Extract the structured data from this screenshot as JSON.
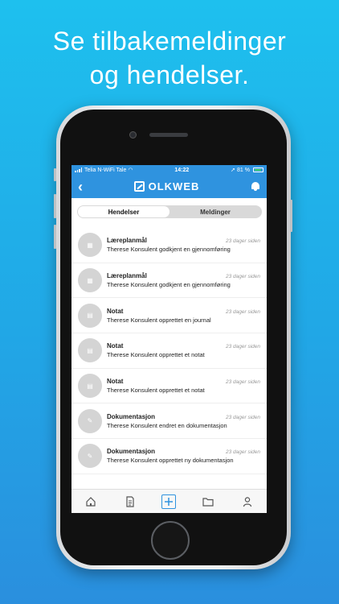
{
  "headline": {
    "line1": "Se tilbakemeldinger",
    "line2": "og hendelser."
  },
  "status_bar": {
    "carrier": "Telia N-WiFi Tale",
    "time": "14:22",
    "battery": "81 %"
  },
  "nav": {
    "brand": "OLKWEB"
  },
  "segments": {
    "events": "Hendelser",
    "messages": "Meldinger"
  },
  "events": [
    {
      "title": "Læreplanmål",
      "description": "Therese Konsulent godkjent en gjennomføring",
      "time": "23 dager siden",
      "icon": "checklist-icon"
    },
    {
      "title": "Læreplanmål",
      "description": "Therese Konsulent godkjent en gjennomføring",
      "time": "23 dager siden",
      "icon": "checklist-icon"
    },
    {
      "title": "Notat",
      "description": "Therese Konsulent opprettet en journal",
      "time": "23 dager siden",
      "icon": "note-icon"
    },
    {
      "title": "Notat",
      "description": "Therese Konsulent opprettet et notat",
      "time": "23 dager siden",
      "icon": "note-icon"
    },
    {
      "title": "Notat",
      "description": "Therese Konsulent opprettet et notat",
      "time": "23 dager siden",
      "icon": "note-icon"
    },
    {
      "title": "Dokumentasjon",
      "description": "Therese Konsulent endret en dokumentasjon",
      "time": "23 dager siden",
      "icon": "pencil-icon"
    },
    {
      "title": "Dokumentasjon",
      "description": "Therese Konsulent opprettet ny dokumentasjon",
      "time": "23 dager siden",
      "icon": "pencil-icon"
    }
  ],
  "colors": {
    "brand_blue": "#2f93df",
    "background_top": "#1ec0ee",
    "background_bottom": "#2a8fde"
  }
}
